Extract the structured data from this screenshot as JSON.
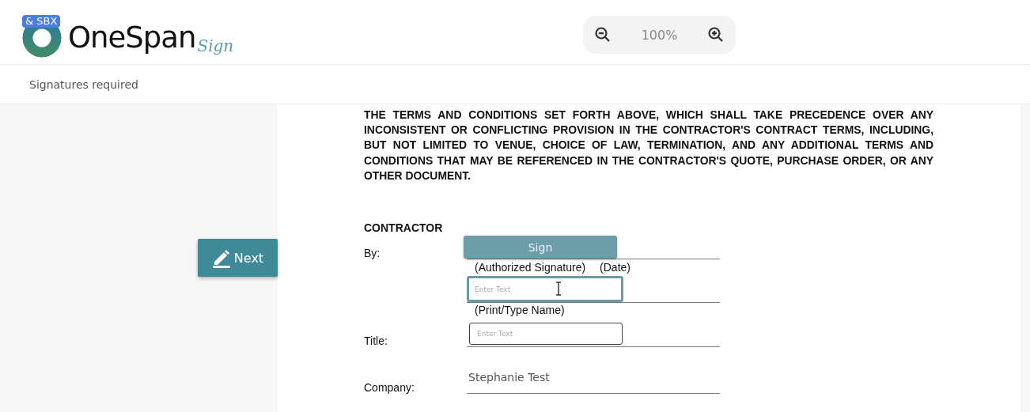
{
  "header": {
    "badge": "& SBX",
    "logo_text": "OneSpan",
    "logo_script": "Sign",
    "zoom": {
      "value": "100%"
    }
  },
  "status_bar": {
    "text": "Signatures required"
  },
  "next_button": {
    "label": "Next"
  },
  "document": {
    "paragraph": "THE TERMS AND CONDITIONS SET FORTH ABOVE, WHICH SHALL TAKE PRECEDENCE OVER ANY INCONSISTENT OR CONFLICTING PROVISION IN THE CONTRACTOR'S CONTRACT TERMS, INCLUDING, BUT NOT LIMITED TO VENUE, CHOICE OF LAW, TERMINATION, AND ANY ADDITIONAL TERMS AND CONDITIONS THAT MAY BE REFERENCED IN THE CONTRACTOR'S QUOTE, PURCHASE ORDER, OR ANY OTHER DOCUMENT.",
    "heading": "CONTRACTOR",
    "by_label": "By:",
    "sign_button": "Sign",
    "signature_caption": "(Authorized Signature)",
    "date_caption": "(Date)",
    "name_field": {
      "placeholder": "Enter Text",
      "focused": true
    },
    "name_caption": "(Print/Type Name)",
    "title_label": "Title:",
    "title_field": {
      "placeholder": "Enter Text",
      "focused": false
    },
    "company_label": "Company:",
    "company_value": "Stephanie Test"
  }
}
